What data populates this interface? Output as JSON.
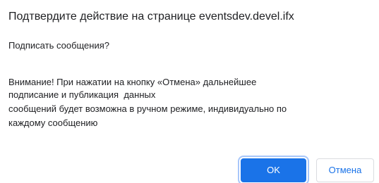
{
  "dialog": {
    "title": "Подтвердите действие на странице eventsdev.devel.ifx",
    "question": "Подписать сообщения?",
    "warning_lines": [
      "Внимание! При нажатии на кнопку «Отмена» дальнейшее",
      "подписание и публикация  данных",
      "сообщений будет возможна в ручном режиме, индивидуально по",
      "каждому сообщению"
    ],
    "ok_label": "OK",
    "cancel_label": "Отмена"
  },
  "colors": {
    "accent": "#1a73e8",
    "text": "#202124",
    "button_border": "#dadce0"
  }
}
